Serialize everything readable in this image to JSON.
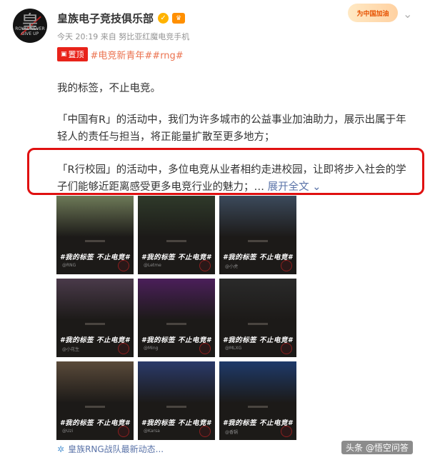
{
  "account": {
    "name": "皇族电子竞技俱乐部",
    "avatar_glyph": "皇",
    "avatar_sub": "ROYAL NEVER GIVE UP",
    "verified_icon": "verified-check-icon",
    "vip_icon": "vip-crown-icon",
    "meta": "今天 20:19 来自 努比亚红魔电竞手机",
    "badge": "为中国加油"
  },
  "post": {
    "pin_label": "置顶",
    "hashtags": "#电竞新青年##rng#",
    "para1": "我的标签，不止电竞。",
    "para2": "「中国有R」的活动中，我们为许多城市的公益事业加油助力，展示出属于年轻人的责任与担当，将正能量扩散至更多地方；",
    "para3": "「R行校园」的活动中，多位电竞从业者相约走进校园，让即将步入社会的学子们能够近距离感受更多电竞行业的魅力；",
    "ellipsis": "…",
    "expand_label": "展开全文",
    "expand_icon": "chevron-down-icon"
  },
  "tiles": [
    {
      "slogan": "#我的标签 不止电竞#",
      "caption": "@RNG",
      "photo": "#6e7a58"
    },
    {
      "slogan": "#我的标签 不止电竞#",
      "caption": "@Letme",
      "photo": "#2f3a2a"
    },
    {
      "slogan": "#我的标签 不止电竞#",
      "caption": "@小虎",
      "photo": "#3c4a5c"
    },
    {
      "slogan": "#我的标签 不止电竞#",
      "caption": "@小花生",
      "photo": "#4a3a4a"
    },
    {
      "slogan": "#我的标签 不止电竞#",
      "caption": "@Ming",
      "photo": "#4b1f5a"
    },
    {
      "slogan": "#我的标签 不止电竞#",
      "caption": "@MLXG",
      "photo": "#2a2a2a"
    },
    {
      "slogan": "#我的标签 不止电竞#",
      "caption": "@Uzi",
      "photo": "#5a4a3a"
    },
    {
      "slogan": "#我的标签 不止电竞#",
      "caption": "@Karsa",
      "photo": "#2a3a6a"
    },
    {
      "slogan": "#我的标签 不止电竞#",
      "caption": "@香锅",
      "photo": "#1e3a6a"
    }
  ],
  "footer": {
    "link": "皇族RNG战队最新动态...",
    "icon": "gear-icon",
    "watermark": "头条 @悟空问答"
  },
  "colors": {
    "highlight": "#e01010",
    "link": "#5a73a8",
    "hashtag": "#eb7350",
    "pin": "#e8231a"
  }
}
